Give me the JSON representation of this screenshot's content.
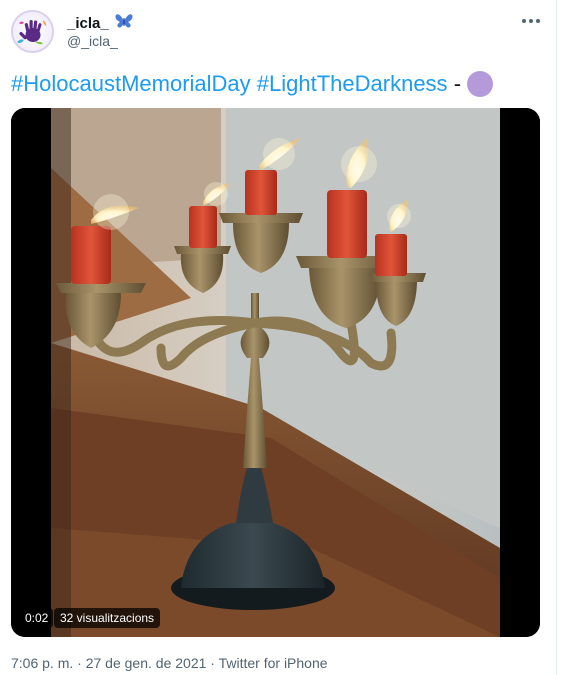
{
  "author": {
    "display_name": "_icla_",
    "badge_icon": "butterfly-icon",
    "handle": "@_icla_",
    "avatar_icon": "purple-handprint-avatar"
  },
  "tweet": {
    "hashtag_1": "#HolocaustMemorialDay",
    "hashtag_2": "#LightTheDarkness",
    "separator": "-",
    "emoji": "purple-circle"
  },
  "video": {
    "duration": "0:02",
    "views": "32 visualitzacions"
  },
  "meta": {
    "time": "7:06 p. m.",
    "dot_1": "·",
    "date": "27 de gen. de 2021",
    "dot_2": "·",
    "source": "Twitter for iPhone"
  },
  "colors": {
    "accent": "#1d9bf0",
    "secondary_text": "#536471",
    "emoji_purple": "#b49ad9",
    "butterfly_blue": "#4a7bd8"
  },
  "icons": [
    "butterfly-icon",
    "more-icon",
    "purple-circle-emoji"
  ]
}
